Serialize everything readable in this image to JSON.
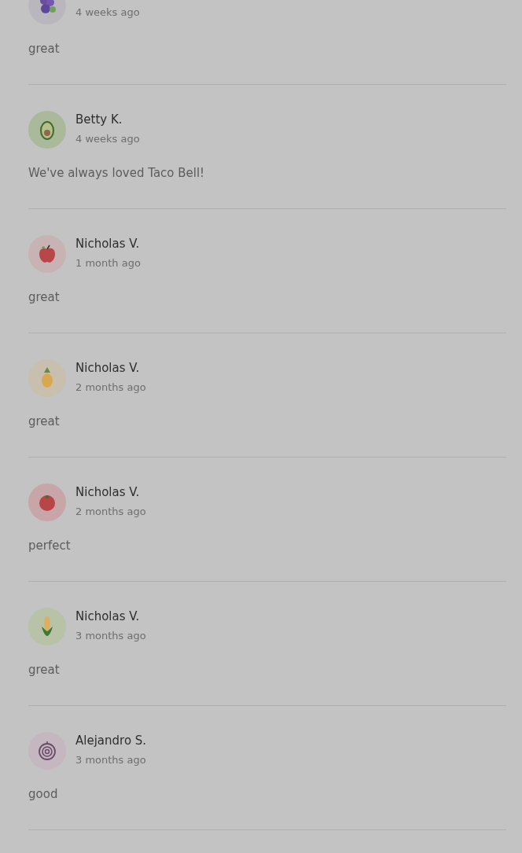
{
  "reviews": [
    {
      "kind": "berries",
      "time": "4 weeks ago",
      "text": "great"
    },
    {
      "kind": "avocado",
      "name": "Betty K.",
      "time": "4 weeks ago",
      "text": "We've always loved Taco Bell!"
    },
    {
      "kind": "apple",
      "name": "Nicholas V.",
      "time": "1 month ago",
      "text": "great"
    },
    {
      "kind": "pineapple",
      "name": "Nicholas V.",
      "time": "2 months ago",
      "text": "great"
    },
    {
      "kind": "tomato",
      "name": "Nicholas V.",
      "time": "2 months ago",
      "text": "perfect"
    },
    {
      "kind": "corn",
      "name": "Nicholas V.",
      "time": "3 months ago",
      "text": "great"
    },
    {
      "kind": "onion",
      "name": "Alejandro S.",
      "time": "3 months ago",
      "text": "good"
    }
  ]
}
